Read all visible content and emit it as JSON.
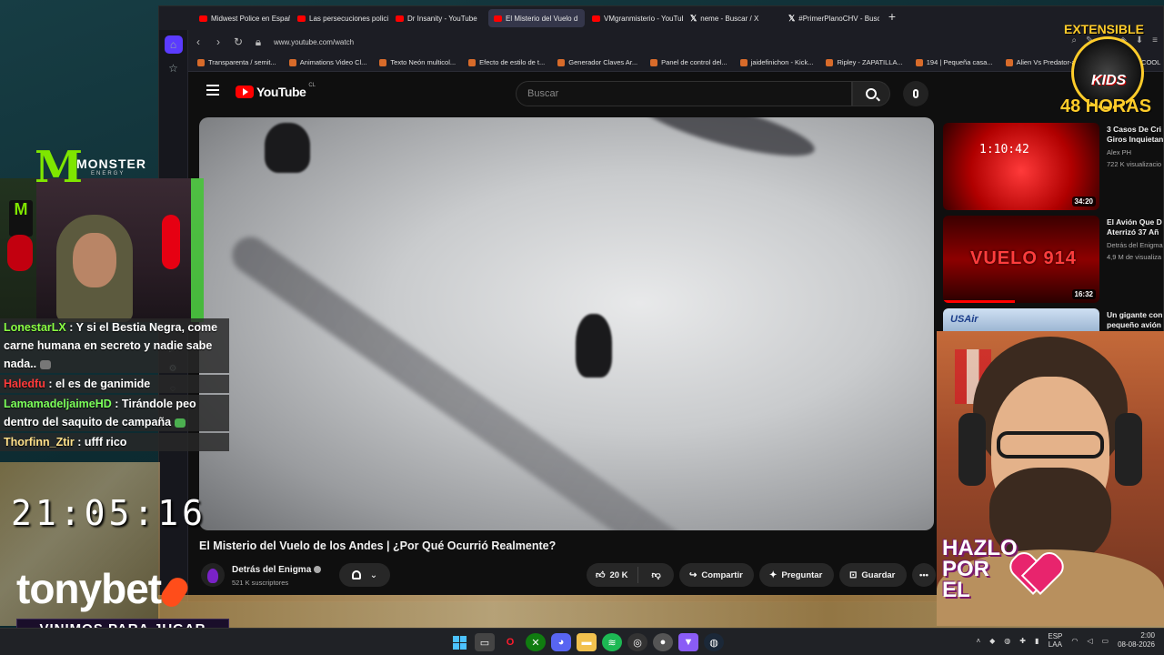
{
  "browser": {
    "tabs": [
      {
        "label": "Midwest Police en Españo",
        "icon": "youtube-icon",
        "active": false
      },
      {
        "label": "Las persecuciones policial",
        "icon": "youtube-icon",
        "active": false
      },
      {
        "label": "Dr Insanity - YouTube",
        "icon": "youtube-icon",
        "active": false
      },
      {
        "label": "El Misterio del Vuelo d",
        "icon": "youtube-icon",
        "active": true
      },
      {
        "label": "VMgranmisterio - YouTub",
        "icon": "youtube-icon",
        "active": false
      },
      {
        "label": "neme - Buscar / X",
        "icon": "x-icon",
        "active": false
      },
      {
        "label": "#PrimerPlanoCHV - Busca",
        "icon": "x-icon",
        "active": false
      }
    ],
    "url": "www.youtube.com/watch",
    "bookmarks": [
      "Transparenta / semit...",
      "Animations Video Cl...",
      "Texto Neón multicol...",
      "Efecto de estilo de t...",
      "Generador Claves Ar...",
      "Panel de control del...",
      "jaidefinichon - Kick...",
      "Ripley - ZAPATILLA...",
      "194 | Pequeña casa...",
      "Alien Vs Predator-alf...",
      "cre",
      "COOL"
    ]
  },
  "youtube": {
    "logo_text": "YouTube",
    "logo_country": "CL",
    "search_placeholder": "Buscar",
    "video": {
      "title": "El Misterio del Vuelo de los Andes | ¿Por Qué Ocurrió Realmente?",
      "channel": "Detrás del Enigma",
      "subscribers": "521 K suscriptores",
      "likes": "20 K",
      "share_label": "Compartir",
      "ask_label": "Preguntar",
      "save_label": "Guardar"
    },
    "recommendations": [
      {
        "title1": "3 Casos De Cri",
        "title2": "Giros Inquietan",
        "channel": "Alex PH",
        "views": "722 K visualizacio",
        "duration": "34:20",
        "overlay": "1:10:42"
      },
      {
        "title1": "El Avión Que D",
        "title2": "Aterrizó 37 Añ",
        "channel": "Detrás del Enigma",
        "views": "4,9 M de visualiza",
        "duration": "16:32",
        "overlay": "VUELO 914"
      },
      {
        "title1": "Un gigante con",
        "title2": "pequeño avión",
        "overlay": "USAir"
      }
    ]
  },
  "overlays": {
    "monster": {
      "word": "MONSTER",
      "sub": "ENERGY"
    },
    "chat": [
      {
        "user": "LonestarLX",
        "text": ": Y si el Bestia Negra, come carne humana en secreto y nadie sabe nada.."
      },
      {
        "user": "Haledfu",
        "text": ": el es de ganimide"
      },
      {
        "user": "LamamadeljaimeHD",
        "text": ": Tirándole peo dentro del saquito de campaña"
      },
      {
        "user": "Thorfinn_Ztir",
        "text": ": ufff rico"
      }
    ],
    "clock": "21:05:16",
    "tonybet": "tonybet",
    "tonybet_slogan": "VINIMOS PARA JUGAR",
    "kids": {
      "top": "EXTENSIBLE",
      "word": "KIDS",
      "hours": "48 HORAS"
    },
    "hazlo": {
      "l1": "HAZLO",
      "l2": "POR",
      "l3": "EL"
    }
  },
  "taskbar": {
    "lang1": "ESP",
    "lang2": "LAA",
    "time": "2:00",
    "date": "08-08-2026"
  }
}
